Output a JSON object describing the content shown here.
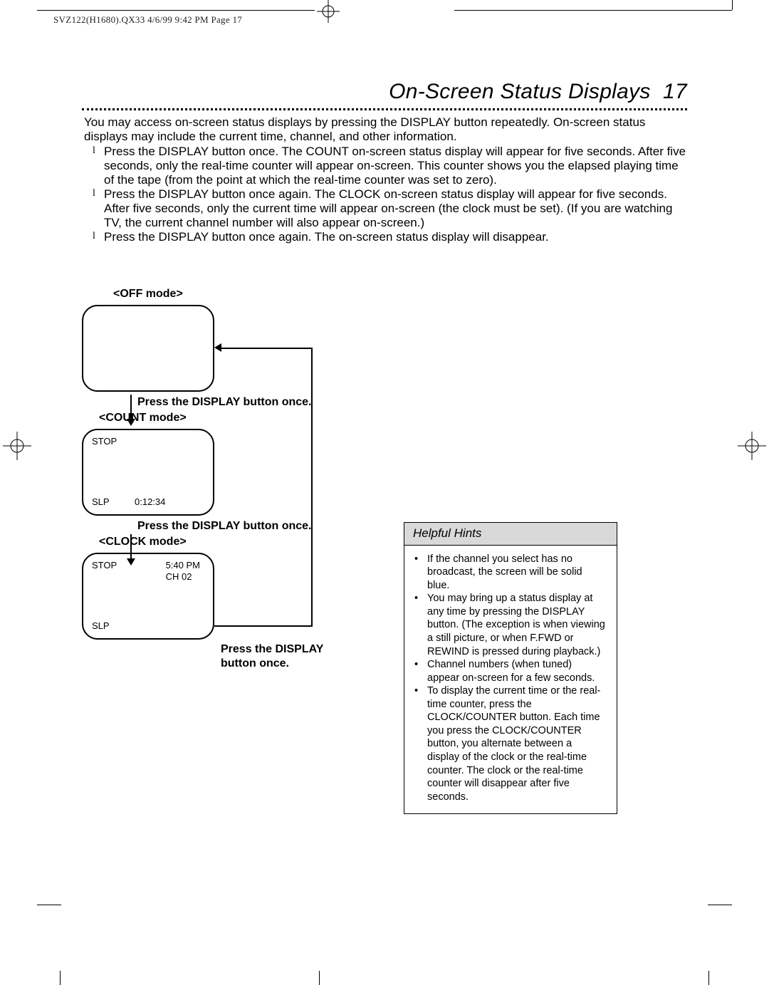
{
  "header_text": "SVZ122(H1680).QX33  4/6/99 9:42 PM  Page 17",
  "title_text": "On-Screen Status Displays",
  "title_page": "17",
  "intro": "You may access on-screen status displays by pressing the DISPLAY button repeatedly. On-screen status displays may include the current time, channel, and other information.",
  "bullets": [
    "Press the DISPLAY button once. The COUNT on-screen status display will appear for five seconds. After five seconds, only the real-time counter will appear on-screen. This counter shows you the elapsed playing time of the tape (from the point at which the real-time counter was set to zero).",
    "Press the DISPLAY button once again. The CLOCK on-screen status display will appear for five seconds. After five seconds, only the current time will appear on-screen (the clock must be set). (If you are watching TV, the current channel number will also appear on-screen.)",
    "Press the DISPLAY button once again. The on-screen status display will disappear."
  ],
  "diagram": {
    "off_label": "<OFF mode>",
    "count_label": "<COUNT mode>",
    "clock_label": "<CLOCK mode>",
    "press_once": "Press the DISPLAY button once.",
    "press_last_1": "Press the DISPLAY",
    "press_last_2": "button once.",
    "count_screen": {
      "tl": "STOP",
      "bl": "SLP",
      "counter": "0:12:34"
    },
    "clock_screen": {
      "tl": "STOP",
      "time": "5:40 PM",
      "ch": "CH 02",
      "bl": "SLP"
    }
  },
  "hints": {
    "title": "Helpful Hints",
    "items": [
      "If the channel you select has no broadcast, the screen will be solid blue.",
      "You may bring up a status display at any time by pressing the DISPLAY button. (The exception is when viewing a still picture, or when F.FWD or REWIND is pressed during playback.)",
      "Channel numbers (when tuned) appear on-screen for a few seconds.",
      "To display the current time or the real-time counter, press the CLOCK/COUNTER button.  Each time you press the CLOCK/COUNTER button, you alternate between a display of the clock or the real-time counter.  The clock or the real-time counter will disappear after five seconds."
    ]
  }
}
